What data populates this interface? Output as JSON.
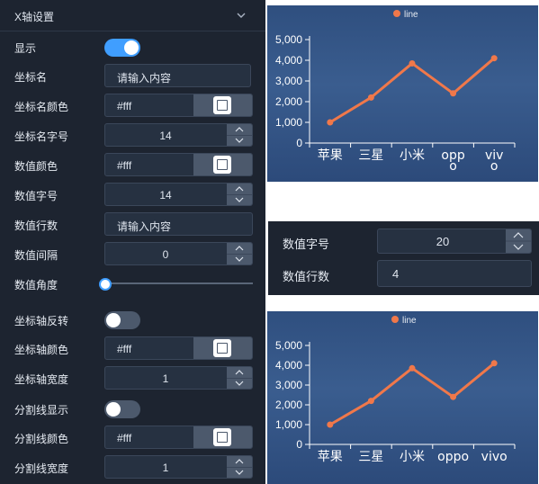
{
  "panel": {
    "title": "X轴设置",
    "rows": {
      "show": {
        "label": "显示",
        "on": true
      },
      "axis_name": {
        "label": "坐标名",
        "placeholder": "请输入内容"
      },
      "axis_name_color": {
        "label": "坐标名颜色",
        "value": "#fff"
      },
      "axis_name_font_size": {
        "label": "坐标名字号",
        "value": "14"
      },
      "value_color": {
        "label": "数值颜色",
        "value": "#fff"
      },
      "value_font_size": {
        "label": "数值字号",
        "value": "14"
      },
      "value_line_count": {
        "label": "数值行数",
        "placeholder": "请输入内容"
      },
      "value_interval": {
        "label": "数值间隔",
        "value": "0"
      },
      "value_angle": {
        "label": "数值角度",
        "value": 0
      },
      "axis_reverse": {
        "label": "坐标轴反转",
        "on": false
      },
      "axis_line_color": {
        "label": "坐标轴颜色",
        "value": "#fff"
      },
      "axis_line_width": {
        "label": "坐标轴宽度",
        "value": "1"
      },
      "split_line_show": {
        "label": "分割线显示",
        "on": false
      },
      "split_line_color": {
        "label": "分割线颜色",
        "value": "#fff"
      },
      "split_line_width": {
        "label": "分割线宽度",
        "value": "1"
      }
    }
  },
  "zoom": {
    "font_size_label": "数值字号",
    "font_size_value": "20",
    "line_count_label": "数值行数",
    "line_count_value": "4"
  },
  "colors": {
    "accent": "#409eff",
    "line": "#f0784a",
    "toggle_off": "#4c596c",
    "panel_bg": "#1d2430"
  },
  "chart_data": [
    {
      "type": "line",
      "legend": "line",
      "categories": [
        "苹果",
        "三星",
        "小米",
        "oppo",
        "vivo"
      ],
      "category_lines": [
        [
          "苹果"
        ],
        [
          "三星"
        ],
        [
          "小米"
        ],
        [
          "opp",
          "o"
        ],
        [
          "viv",
          "o"
        ]
      ],
      "values": [
        1000,
        2200,
        3850,
        2400,
        4100
      ],
      "yticks": [
        "0",
        "1,000",
        "2,000",
        "3,000",
        "4,000",
        "5,000"
      ],
      "ylim": [
        0,
        5000
      ]
    },
    {
      "type": "line",
      "legend": "line",
      "categories": [
        "苹果",
        "三星",
        "小米",
        "oppo",
        "vivo"
      ],
      "category_lines": [
        [
          "苹果"
        ],
        [
          "三星"
        ],
        [
          "小米"
        ],
        [
          "oppo"
        ],
        [
          "vivo"
        ]
      ],
      "values": [
        1000,
        2200,
        3850,
        2400,
        4100
      ],
      "yticks": [
        "0",
        "1,000",
        "2,000",
        "3,000",
        "4,000",
        "5,000"
      ],
      "ylim": [
        0,
        5000
      ]
    }
  ]
}
